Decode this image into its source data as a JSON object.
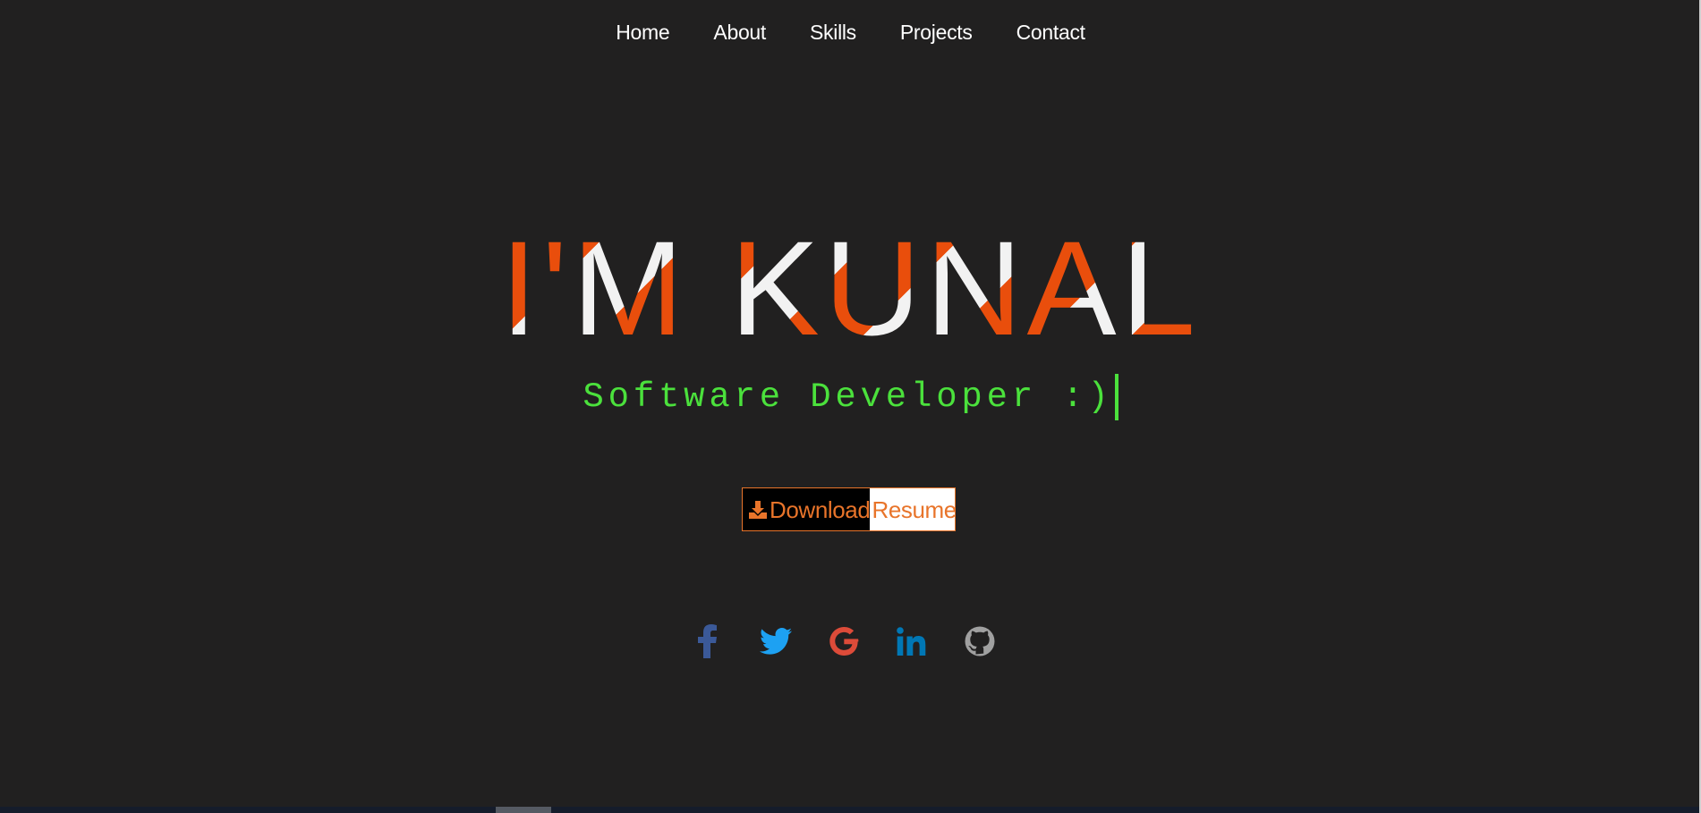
{
  "nav": {
    "items": [
      {
        "label": "Home"
      },
      {
        "label": "About"
      },
      {
        "label": "Skills"
      },
      {
        "label": "Projects"
      },
      {
        "label": "Contact"
      }
    ]
  },
  "hero": {
    "title": "I'M KUNAL",
    "subtitle": "Software Developer :)"
  },
  "resume_button": {
    "download_label": "Download",
    "resume_label": "Resume",
    "icon": "download-icon"
  },
  "socials": [
    {
      "icon": "facebook-icon",
      "color": "#3b5998"
    },
    {
      "icon": "twitter-icon",
      "color": "#1da1f2"
    },
    {
      "icon": "google-icon",
      "color": "#dd4b39"
    },
    {
      "icon": "linkedin-icon",
      "color": "#0077b5"
    },
    {
      "icon": "github-icon",
      "color": "#a0a0a0"
    }
  ],
  "colors": {
    "background": "#212020",
    "accent_orange": "#e94e0c",
    "title_white": "#f2f2f2",
    "subtitle_green": "#4be13c",
    "button_orange": "#e8742a"
  }
}
